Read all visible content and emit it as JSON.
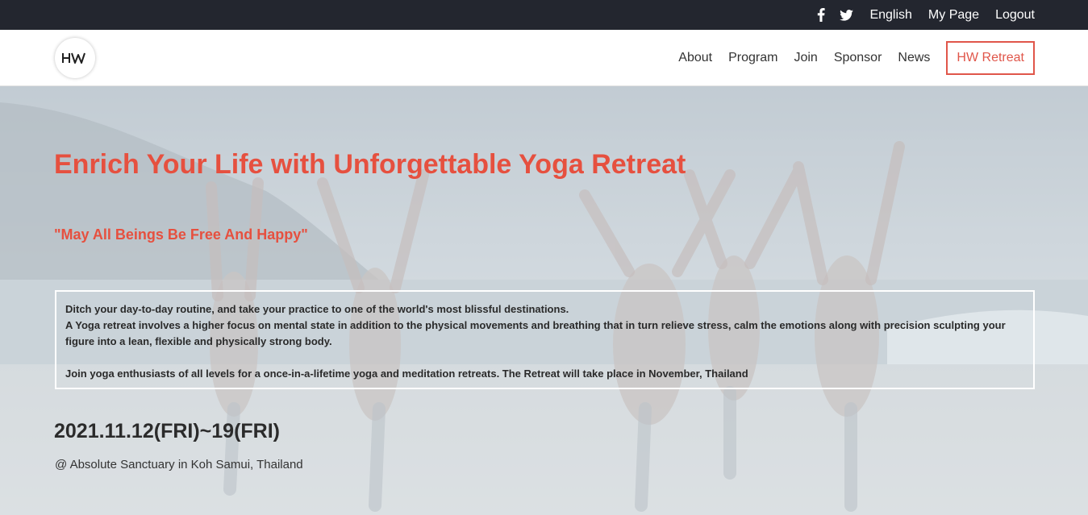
{
  "topbar": {
    "icons": [
      "facebook-icon",
      "twitter-icon"
    ],
    "links": [
      "English",
      "My Page",
      "Logout"
    ]
  },
  "navbar": {
    "logo_text": "HW",
    "items": [
      "About",
      "Program",
      "Join",
      "Sponsor",
      "News"
    ],
    "cta": "HW Retreat"
  },
  "hero": {
    "title": "Enrich Your Life with Unforgettable Yoga Retreat",
    "motto": "\"May All Beings Be Free And Happy\"",
    "description": {
      "line1": "Ditch your day-to-day routine, and take your practice to one of the world's most blissful destinations.",
      "line2": "A Yoga retreat involves a higher focus on mental state in addition to the physical movements and breathing that in turn relieve stress, calm the emotions along with precision sculpting your figure into a lean, flexible and physically strong body.",
      "line3": "Join yoga enthusiasts of all levels for a once-in-a-lifetime yoga and meditation retreats. The Retreat will take place in November, Thailand"
    },
    "date": "2021.11.12(FRI)~19(FRI)",
    "venue": "@ Absolute Sanctuary in Koh Samui, Thailand"
  },
  "colors": {
    "accent": "#e6503f",
    "topbar_bg": "#23262f"
  }
}
